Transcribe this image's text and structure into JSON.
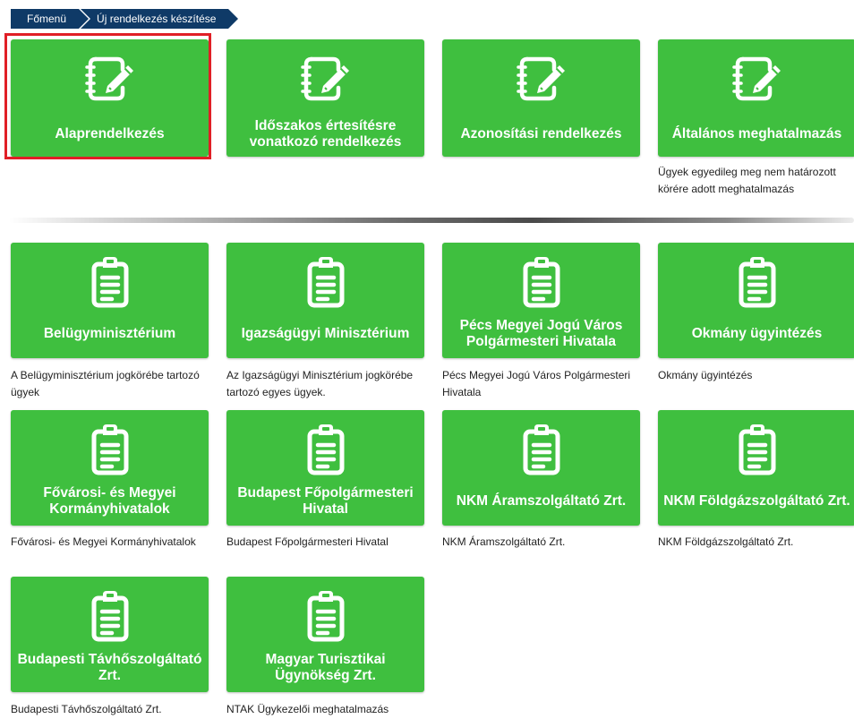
{
  "breadcrumb": [
    "Főmenü",
    "Új rendelkezés készítése"
  ],
  "colors": {
    "tile": "#3fbf3f",
    "breadcrumb": "#0f3a67",
    "selection": "#e01f26"
  },
  "top_tiles": [
    {
      "label": "Alaprendelkezés",
      "description": "",
      "icon": "notebook-pencil-icon",
      "selected": true
    },
    {
      "label": "Időszakos értesítésre vonatkozó rendelkezés",
      "description": "",
      "icon": "notebook-pencil-icon"
    },
    {
      "label": "Azonosítási rendelkezés",
      "description": "",
      "icon": "notebook-pencil-icon"
    },
    {
      "label": "Általános meghatalmazás",
      "description": "Ügyek egyedileg meg nem határozott körére adott meghatalmazás",
      "icon": "notebook-pencil-icon"
    }
  ],
  "org_tiles": [
    {
      "label": "Belügyminisztérium",
      "description": "A Belügyminisztérium jogkörébe tartozó ügyek",
      "icon": "clipboard-icon"
    },
    {
      "label": "Igazságügyi Minisztérium",
      "description": "Az Igazságügyi Minisztérium jogkörébe tartozó egyes ügyek.",
      "icon": "clipboard-icon"
    },
    {
      "label": "Pécs Megyei Jogú Város Polgármesteri Hivatala",
      "description": "Pécs Megyei Jogú Város Polgármesteri Hivatala",
      "icon": "clipboard-icon"
    },
    {
      "label": "Okmány ügyintézés",
      "description": "Okmány ügyintézés",
      "icon": "clipboard-icon"
    },
    {
      "label": "Fővárosi- és Megyei Kormányhivatalok",
      "description": "Fővárosi- és Megyei Kormányhivatalok",
      "icon": "clipboard-icon"
    },
    {
      "label": "Budapest Főpolgármesteri Hivatal",
      "description": "Budapest Főpolgármesteri Hivatal",
      "icon": "clipboard-icon"
    },
    {
      "label": "NKM Áramszolgáltató Zrt.",
      "description": "NKM Áramszolgáltató Zrt.",
      "icon": "clipboard-icon"
    },
    {
      "label": "NKM Földgázszolgáltató Zrt.",
      "description": "NKM Földgázszolgáltató Zrt.",
      "icon": "clipboard-icon"
    },
    {
      "label": "Budapesti Távhőszolgáltató Zrt.",
      "description": "Budapesti Távhőszolgáltató Zrt.",
      "icon": "clipboard-icon"
    },
    {
      "label": "Magyar Turisztikai Ügynökség Zrt.",
      "description": "NTAK Ügykezelői meghatalmazás",
      "icon": "clipboard-icon"
    }
  ]
}
